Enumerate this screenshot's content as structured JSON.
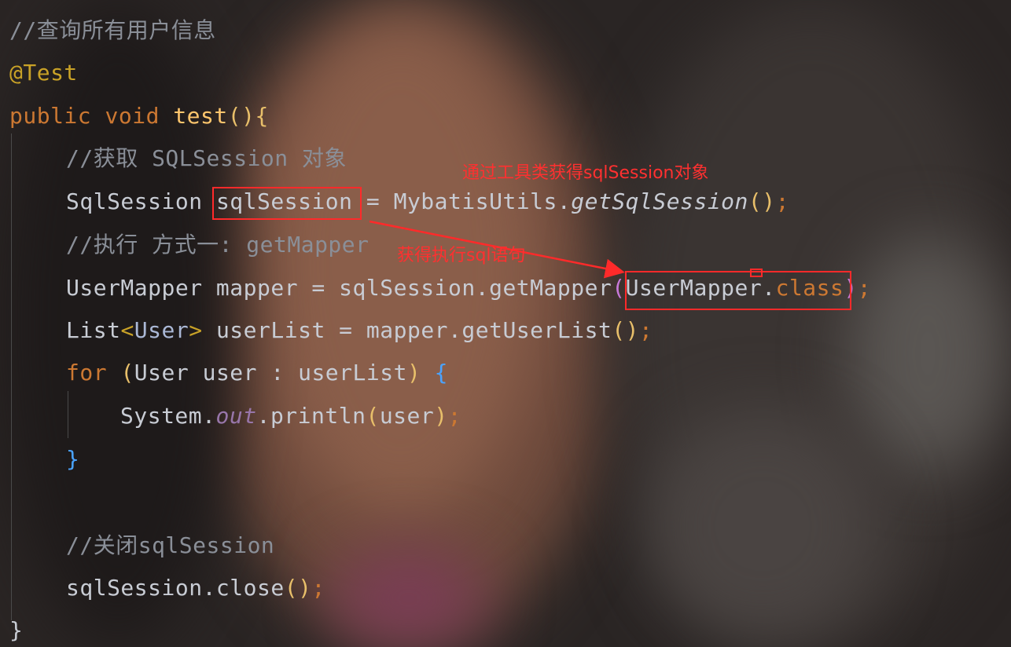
{
  "code": {
    "comment_title": "//查询所有用户信息",
    "annotation": "@Test",
    "kw_public": "public",
    "kw_void": "void",
    "method_name": "test",
    "comment_get_session": "//获取 SQLSession 对象",
    "type_sqlsession": "SqlSession",
    "var_sqlsession": "sqlSession",
    "assign": " = ",
    "utils_class": "MybatisUtils.",
    "utils_method": "getSqlSession",
    "comment_exec": "//执行 方式一: getMapper",
    "mapper_decl": "UserMapper mapper = sqlSession.getMapper",
    "mapper_arg_class": "UserMapper.",
    "kw_class": "class",
    "list_type": "List",
    "generic_user": "User",
    "userlist_decl": " userList = mapper.getUserList",
    "kw_for": "for",
    "for_body": "User user : userList",
    "sys_out_prefix": "System.",
    "sys_out_field": "out",
    "println": ".println",
    "println_arg": "user",
    "comment_close": "//关闭sqlSession",
    "close_stmt": "sqlSession.close",
    "closing_brace": "}"
  },
  "annotations": {
    "label_session": "通过工具类获得sqlSession对象",
    "label_exec": "获得执行sql语句"
  },
  "colors": {
    "annotation_red": "#ff2a2a",
    "keyword": "#cc7832",
    "method": "#ffc66d",
    "comment": "#8a8f98"
  }
}
